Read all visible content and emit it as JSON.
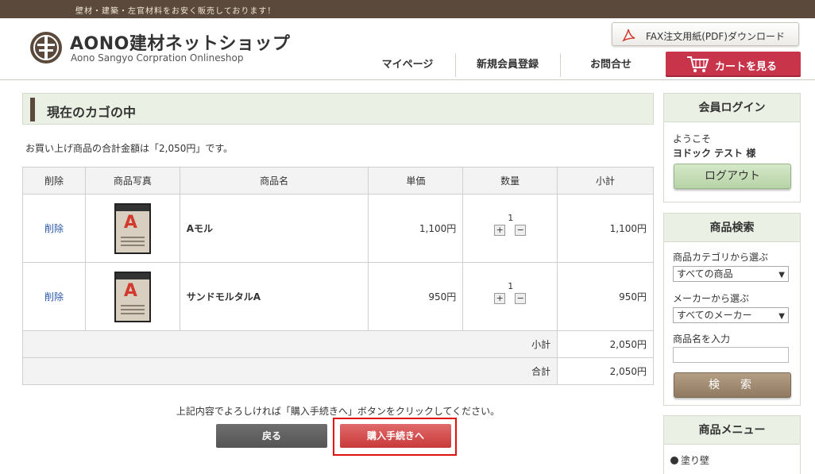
{
  "topbar": {
    "text": "壁材・建築・左官材料をお安く販売しております！"
  },
  "header": {
    "title": "AONO建材ネットショップ",
    "subtitle": "Aono Sangyo  Corpration  Onlineshop",
    "fax_label": "FAX注文用紙(PDF)ダウンロード",
    "nav": [
      "マイページ",
      "新規会員登録",
      "お問合せ"
    ],
    "cart_label": "カートを見る"
  },
  "main": {
    "heading": "現在のカゴの中",
    "total_text": "お買い上げ商品の合計金額は「2,050円」です。",
    "columns": [
      "削除",
      "商品写真",
      "商品名",
      "単価",
      "数量",
      "小計"
    ],
    "rows": [
      {
        "delete": "削除",
        "name": "Aモル",
        "price": "1,100円",
        "qty": "1",
        "subtotal": "1,100円",
        "bag_letter": "A"
      },
      {
        "delete": "削除",
        "name": "サンドモルタルA",
        "price": "950円",
        "qty": "1",
        "subtotal": "950円",
        "bag_letter": "A"
      }
    ],
    "qty_plus": "+",
    "qty_minus": "−",
    "subtotal_label": "小計",
    "subtotal_value": "2,050円",
    "total_label": "合計",
    "total_value": "2,050円",
    "confirm_text": "上記内容でよろしければ「購入手続きへ」ボタンをクリックしてください。",
    "back_label": "戻る",
    "proceed_label": "購入手続きへ"
  },
  "sidebar": {
    "login": {
      "title": "会員ログイン",
      "welcome": "ようこそ",
      "user": "ヨドック テスト 様",
      "logout": "ログアウト"
    },
    "search": {
      "title": "商品検索",
      "category_label": "商品カテゴリから選ぶ",
      "category_value": "すべての商品",
      "maker_label": "メーカーから選ぶ",
      "maker_value": "すべてのメーカー",
      "name_label": "商品名を入力",
      "search_button": "検　索"
    },
    "menu": {
      "title": "商品メニュー",
      "items": [
        "塗り壁"
      ]
    }
  },
  "colors": {
    "brand_brown": "#5b4a3b",
    "accent_red": "#c8344a",
    "green_bg": "#eaf0e4",
    "link_blue": "#2a58a8"
  }
}
